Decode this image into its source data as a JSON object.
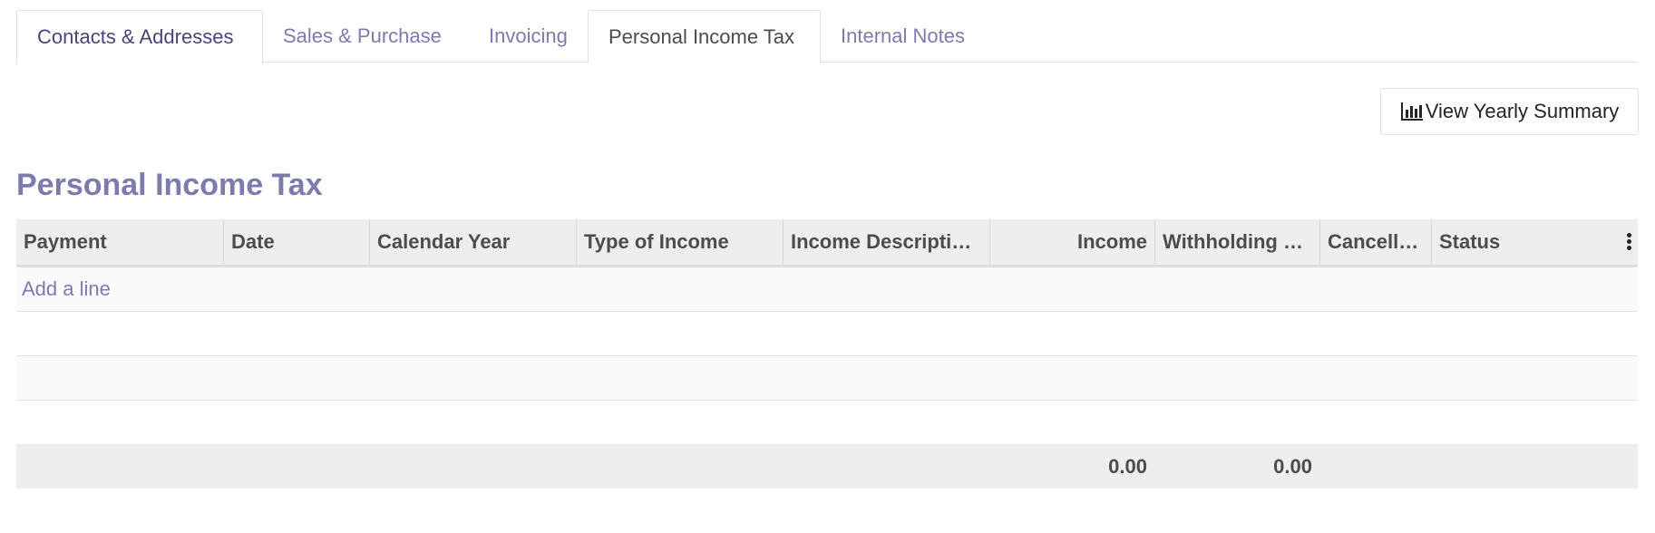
{
  "tabs": [
    {
      "label": "Contacts & Addresses"
    },
    {
      "label": "Sales & Purchase"
    },
    {
      "label": "Invoicing"
    },
    {
      "label": "Personal Income Tax"
    },
    {
      "label": "Internal Notes"
    }
  ],
  "active_tab": "Personal Income Tax",
  "summary_button": {
    "label": "View Yearly Summary",
    "icon": "bar-chart-icon"
  },
  "section_title": "Personal Income Tax",
  "table": {
    "columns": [
      {
        "label": "Payment"
      },
      {
        "label": "Date"
      },
      {
        "label": "Calendar Year"
      },
      {
        "label": "Type of Income"
      },
      {
        "label": "Income Descripti…"
      },
      {
        "label": "Income"
      },
      {
        "label": "Withholding …"
      },
      {
        "label": "Cancell…"
      },
      {
        "label": "Status"
      }
    ],
    "add_line_label": "Add a line",
    "totals": {
      "income": "0.00",
      "withholding": "0.00"
    },
    "column_menu_icon": "vertical-ellipsis-icon"
  },
  "colors": {
    "accent": "#7c7bad",
    "accent_dark": "#47467a",
    "header_bg": "#eeeeee"
  }
}
